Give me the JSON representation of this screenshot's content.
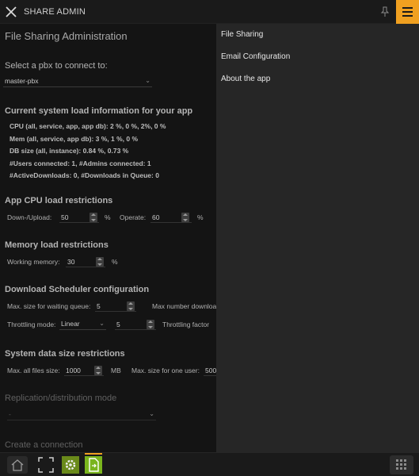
{
  "topbar": {
    "title": "SHARE ADMIN",
    "close_icon": "close-icon",
    "pin_icon": "pin-icon",
    "menu_icon": "hamburger-icon",
    "accent": "#f0a020"
  },
  "main": {
    "title": "File Sharing Administration",
    "pbx": {
      "label": "Select a pbx to connect to:",
      "value": "master-pbx"
    },
    "load": {
      "heading": "Current system load information for your app",
      "lines": [
        "CPU (all, service, app, app db): 2 %, 0 %, 2%, 0 %",
        "Mem (all, service, app db): 3 %, 1 %, 0 %",
        "DB size (all, instance): 0.84 %, 0.73 %",
        "#Users connected: 1, #Admins connected: 1",
        "#ActiveDownloads: 0, #Downloads in Queue: 0"
      ]
    },
    "cpu": {
      "heading": "App CPU load restrictions",
      "down_label": "Down-/Upload:",
      "down_value": "50",
      "operate_label": "Operate:",
      "operate_value": "60",
      "unit": "%"
    },
    "memory": {
      "heading": "Memory load restrictions",
      "label": "Working memory:",
      "value": "30",
      "unit": "%"
    },
    "scheduler": {
      "heading": "Download Scheduler configuration",
      "max_queue_label": "Max. size for waiting queue:",
      "max_queue_value": "5",
      "max_download_label": "Max number downloa",
      "throttling_label": "Throttling mode:",
      "throttling_value": "Linear",
      "throttling_num": "5",
      "throttling_factor_label": "Throttling factor"
    },
    "datasize": {
      "heading": "System data size restrictions",
      "all_label": "Max. all files size:",
      "all_value": "1000",
      "all_unit": "MB",
      "user_label": "Max. size for one user:",
      "user_value": "500"
    },
    "replication": {
      "heading": "Replication/distribution mode",
      "value": "-"
    },
    "connection": {
      "heading": "Create a connection"
    }
  },
  "sidemenu": {
    "items": [
      "File Sharing",
      "Email Configuration",
      "About the app"
    ]
  },
  "bottombar": {
    "icons": [
      "home-icon",
      "fullscreen-icon",
      "settings-app-icon",
      "file-share-app-icon",
      "apps-grid-icon"
    ]
  }
}
